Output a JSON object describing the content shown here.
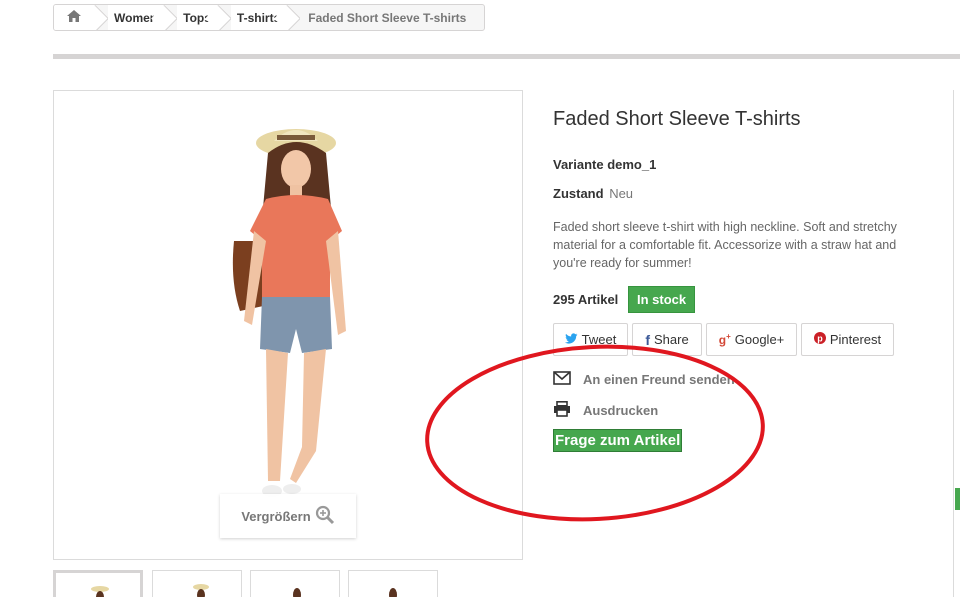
{
  "breadcrumb": {
    "home_icon": "home-icon",
    "items": [
      "Women",
      "Tops",
      "T-shirts"
    ],
    "current": "Faded Short Sleeve T-shirts"
  },
  "product": {
    "title": "Faded Short Sleeve T-shirts",
    "reference": "Variante demo_1",
    "condition_label": "Zustand",
    "condition_value": "Neu",
    "description": "Faded short sleeve t-shirt with high neckline. Soft and stretchy material for a comfortable fit. Accessorize with a straw hat and you're ready for summer!",
    "quantity": "295 Artikel",
    "stock": "In stock",
    "zoom_label": "Vergrößern"
  },
  "social": {
    "tweet": "Tweet",
    "share": "Share",
    "gplus": "Google+",
    "pinterest": "Pinterest"
  },
  "actions": {
    "send_friend": "An einen Freund senden",
    "print": "Ausdrucken",
    "ask": "Frage zum Artikel"
  },
  "colors": {
    "accent_green": "#46a74e",
    "annotation_red": "#e0171f"
  }
}
